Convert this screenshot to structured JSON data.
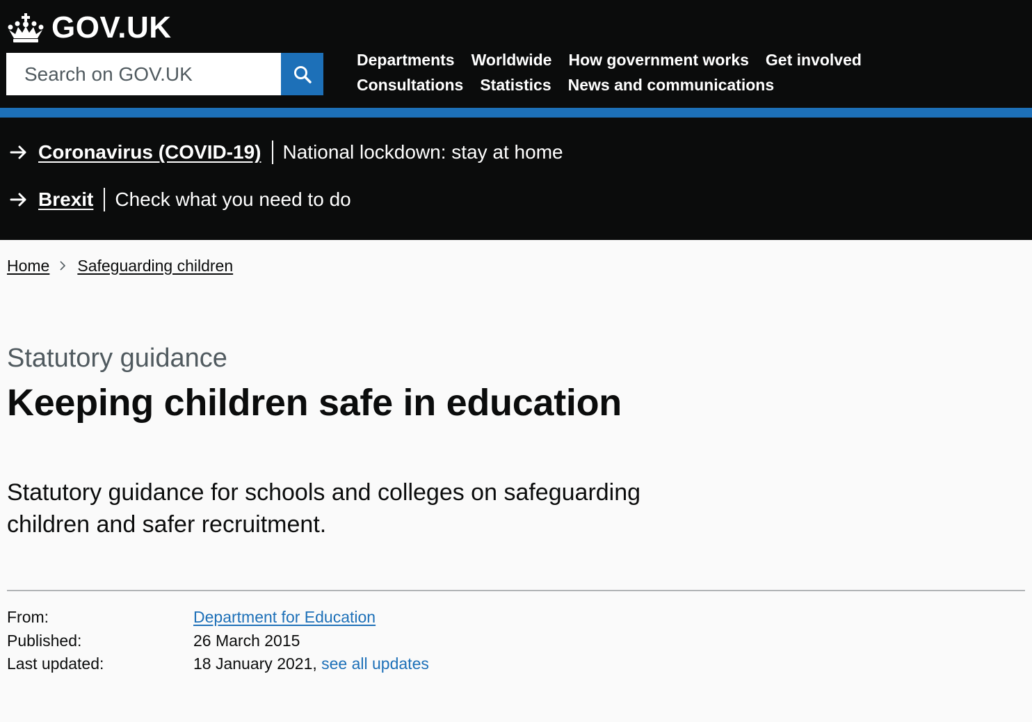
{
  "header": {
    "logo_text": "GOV.UK",
    "search": {
      "placeholder": "Search on GOV.UK",
      "icon": "search-icon"
    },
    "nav_row1": [
      "Departments",
      "Worldwide",
      "How government works",
      "Get involved"
    ],
    "nav_row2": [
      "Consultations",
      "Statistics",
      "News and communications"
    ]
  },
  "global_bar": {
    "items": [
      {
        "link": "Coronavirus (COVID-19)",
        "text": "National lockdown: stay at home"
      },
      {
        "link": "Brexit",
        "text": "Check what you need to do"
      }
    ]
  },
  "breadcrumb": {
    "items": [
      "Home",
      "Safeguarding children"
    ]
  },
  "page": {
    "caption": "Statutory guidance",
    "title": "Keeping children safe in education",
    "lead": "Statutory guidance for schools and colleges on safeguarding children and safer recruitment."
  },
  "metadata": {
    "from_label": "From:",
    "from_value": "Department for Education",
    "published_label": "Published:",
    "published_value": "26 March 2015",
    "updated_label": "Last updated:",
    "updated_value": "18 January 2021,",
    "updated_link": "see all updates"
  },
  "colors": {
    "header_bg": "#0b0c0c",
    "accent_blue": "#1d70b8",
    "page_bg": "#fafafa",
    "caption_grey": "#505a5f"
  }
}
